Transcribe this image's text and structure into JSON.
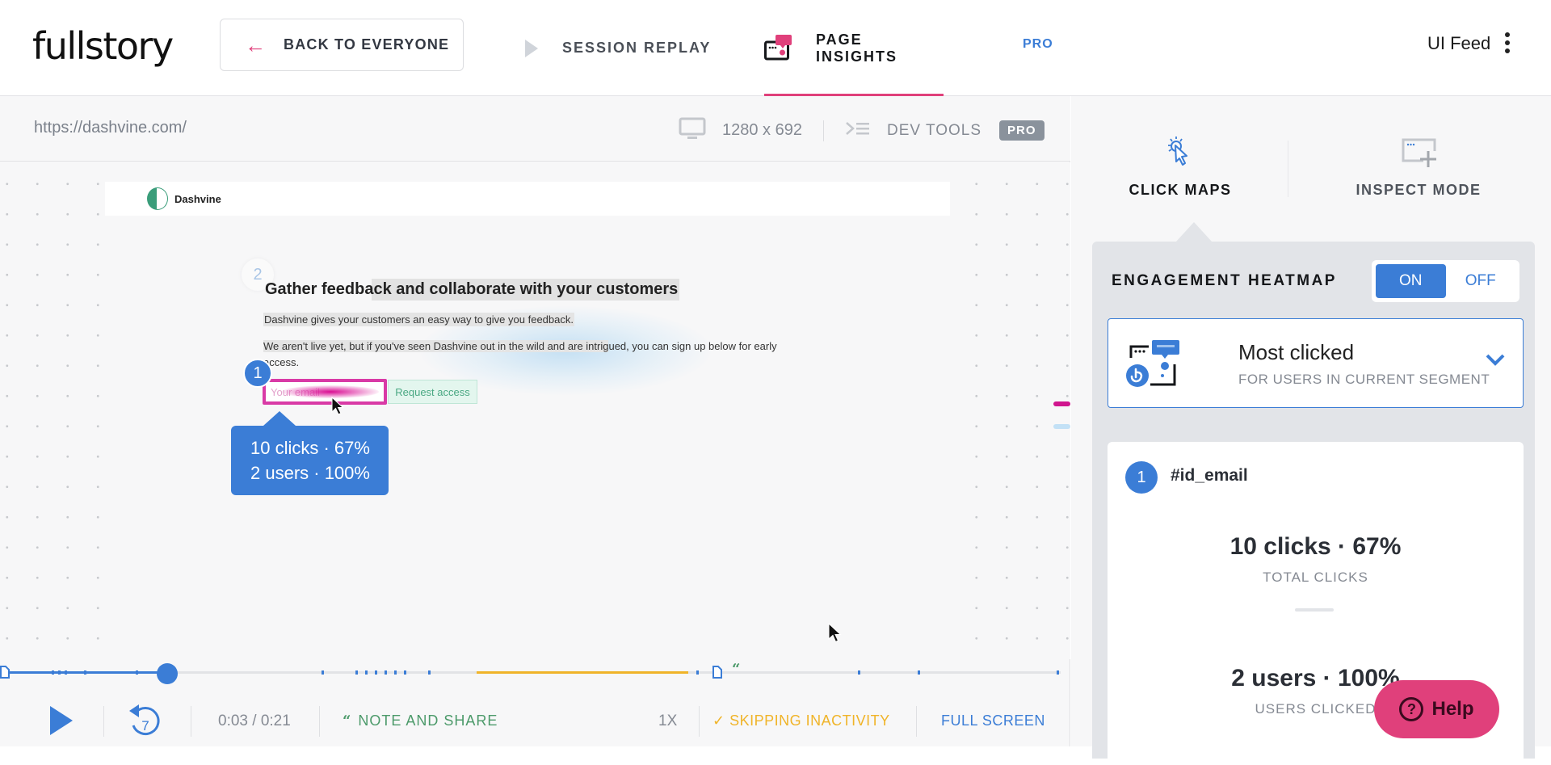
{
  "brand": {
    "logo_text": "fullstory",
    "accent": "#e0407b",
    "primary": "#3b7dd6"
  },
  "topnav": {
    "back_label": "BACK TO EVERYONE",
    "tabs": [
      {
        "label": "SESSION REPLAY",
        "active": false
      },
      {
        "label": "PAGE INSIGHTS",
        "active": true
      }
    ],
    "pro_label": "PRO",
    "user_name": "UI Feed"
  },
  "player": {
    "url": "https://dashvine.com/",
    "resolution": "1280 x 692",
    "dev_tools_label": "DEV TOOLS",
    "dev_tools_badge": "PRO",
    "site": {
      "name": "Dashvine",
      "marker_2": "2",
      "title": "Gather feedback and collaborate with your customers",
      "paragraph1": "Dashvine gives your customers an easy way to give you feedback.",
      "paragraph2_highlighted": "We aren't live yet, but if you've seen Dashvine out in the wild and are intrig",
      "paragraph2_rest": "ued, you can sign up below for early access.",
      "email_placeholder": "Your email",
      "request_button": "Request access",
      "marker_1": "1"
    },
    "tooltip": {
      "line1": "10 clicks · 67%",
      "line2": "2 users · 100%"
    },
    "timeline": {
      "progress": 0.15,
      "time": "0:03 / 0:21"
    },
    "controls": {
      "rewind_seconds": "7",
      "note_share_label": "NOTE AND SHARE",
      "speed": "1X",
      "skip_label": "SKIPPING INACTIVITY",
      "fullscreen_label": "FULL SCREEN"
    }
  },
  "rpanel": {
    "modes": [
      {
        "label": "CLICK MAPS",
        "active": true
      },
      {
        "label": "INSPECT MODE",
        "active": false
      }
    ],
    "heatmap_title": "ENGAGEMENT HEATMAP",
    "toggle": {
      "on": "ON",
      "off": "OFF",
      "value": "ON"
    },
    "select": {
      "title": "Most clicked",
      "subtitle": "FOR USERS IN CURRENT SEGMENT"
    },
    "stat": {
      "rank": "1",
      "selector": "#id_email",
      "clicks_value": "10 clicks · 67%",
      "clicks_label": "TOTAL CLICKS",
      "users_value": "2 users · 100%",
      "users_label": "USERS CLICKED"
    },
    "help_label": "Help"
  }
}
